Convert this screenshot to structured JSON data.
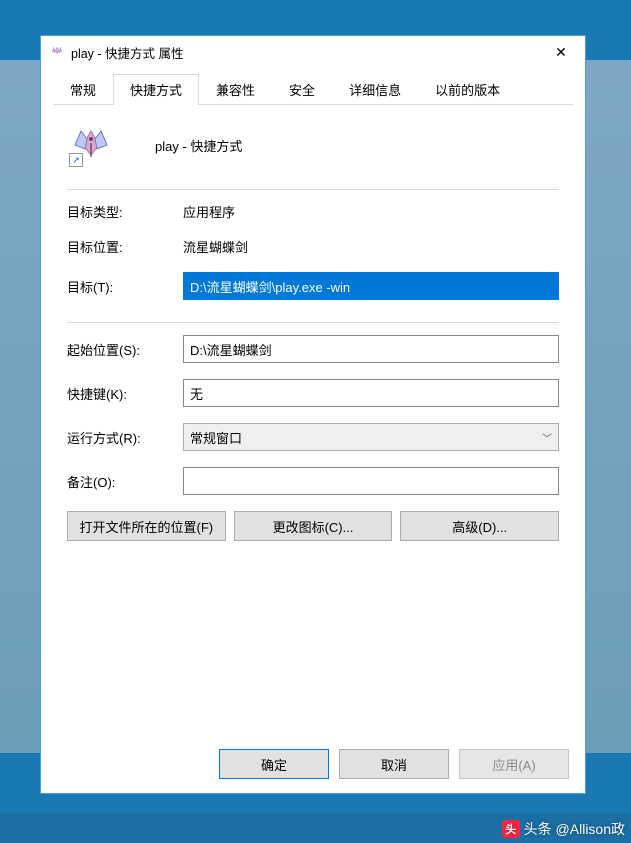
{
  "titlebar": {
    "title": "play - 快捷方式 属性"
  },
  "tabs": {
    "general": "常规",
    "shortcut": "快捷方式",
    "compat": "兼容性",
    "security": "安全",
    "details": "详细信息",
    "prev": "以前的版本"
  },
  "header": {
    "name": "play - 快捷方式"
  },
  "labels": {
    "target_type": "目标类型:",
    "target_loc": "目标位置:",
    "target": "目标(T):",
    "startin": "起始位置(S):",
    "hotkey": "快捷键(K):",
    "run": "运行方式(R):",
    "comment": "备注(O):"
  },
  "values": {
    "target_type": "应用程序",
    "target_loc": "流星蝴蝶剑",
    "target": "D:\\流星蝴蝶剑\\play.exe -win",
    "startin": "D:\\流星蝴蝶剑",
    "hotkey": "无",
    "run": "常规窗口",
    "comment": ""
  },
  "buttons": {
    "open_loc": "打开文件所在的位置(F)",
    "change_icon": "更改图标(C)...",
    "advanced": "高级(D)..."
  },
  "footer": {
    "ok": "确定",
    "cancel": "取消",
    "apply": "应用(A)"
  },
  "watermark": "头条 @Allison政"
}
